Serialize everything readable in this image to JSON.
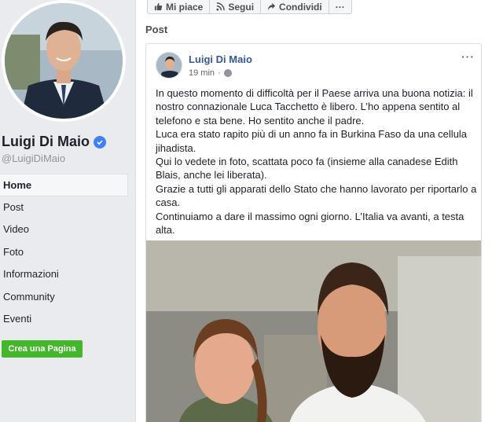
{
  "profile": {
    "name": "Luigi Di Maio",
    "handle": "@LuigiDiMaio"
  },
  "nav": {
    "items": [
      {
        "label": "Home"
      },
      {
        "label": "Post"
      },
      {
        "label": "Video"
      },
      {
        "label": "Foto"
      },
      {
        "label": "Informazioni"
      },
      {
        "label": "Community"
      },
      {
        "label": "Eventi"
      }
    ],
    "active": "Home",
    "create_page_label": "Crea una Pagina"
  },
  "action_bar": {
    "like_label": "Mi piace",
    "follow_label": "Segui",
    "share_label": "Condividi",
    "more_label": "···"
  },
  "section": {
    "title": "Post"
  },
  "post": {
    "author": "Luigi Di Maio",
    "time": "19 min",
    "more_label": "···",
    "paragraphs": [
      "In questo momento di difficoltà per il Paese arriva una buona notizia: il nostro connazionale Luca Tacchetto è libero. L’ho appena sentito al telefono e sta bene. Ho sentito anche il padre.",
      "Luca era stato rapito più di un anno fa in Burkina Faso da una cellula jihadista.",
      "Qui lo vedete in foto, scattata poco fa (insieme alla canadese Edith Blais, anche lei liberata).",
      "Grazie a tutti gli apparati dello Stato che hanno lavorato per riportarlo a casa.",
      "Continuiamo a dare il massimo ogni giorno. L’Italia va avanti, a testa alta."
    ]
  },
  "colors": {
    "link": "#365899",
    "verified": "#4080ff",
    "create_button": "#42b72a",
    "background": "#e9ebee"
  }
}
